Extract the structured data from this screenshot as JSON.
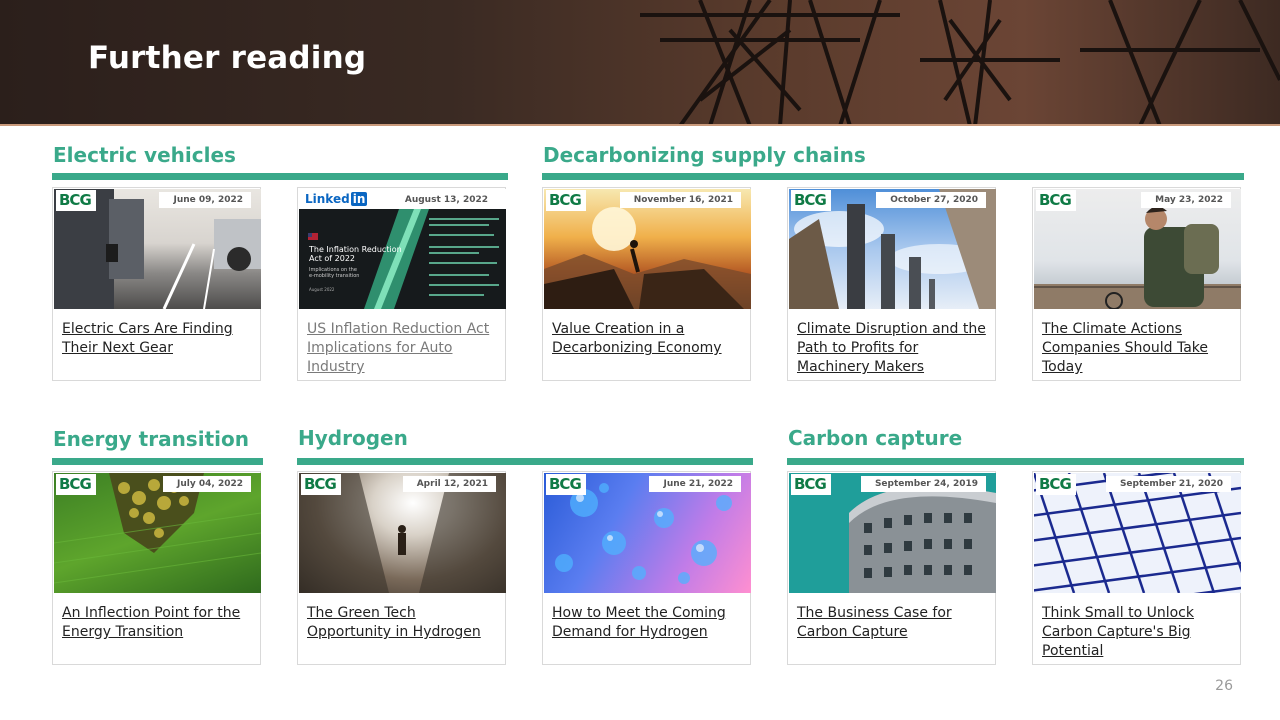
{
  "slide": {
    "title": "Further reading",
    "page_number": "26"
  },
  "sections": {
    "electric_vehicles": "Electric vehicles",
    "decarbonizing_supply_chains": "Decarbonizing supply chains",
    "energy_transition": "Energy transition",
    "hydrogen": "Hydrogen",
    "carbon_capture": "Carbon capture"
  },
  "brand": {
    "bcg": "BCG",
    "linkedin_text": "Linked",
    "linkedin_box": "in"
  },
  "thumbnail_text": {
    "inflation_title_1": "The Inflation Reduction",
    "inflation_title_2": "Act of 2022",
    "inflation_sub_1": "Implications on the",
    "inflation_sub_2": "e-mobility transition",
    "inflation_date": "August 2022"
  },
  "cards": [
    {
      "date": "June 09, 2022",
      "title": "Electric Cars Are Finding Their Next Gear"
    },
    {
      "date": "August 13, 2022",
      "title": "US Inflation Reduction Act Implications for Auto Industry"
    },
    {
      "date": "November 16, 2021",
      "title": "Value Creation in a Decarbonizing Economy"
    },
    {
      "date": "October 27, 2020",
      "title": "Climate Disruption and the Path to Profits for Machinery Makers"
    },
    {
      "date": "May 23, 2022",
      "title": "The Climate Actions Companies Should Take Today"
    },
    {
      "date": "July 04, 2022",
      "title": "An Inflection Point for the Energy Transition"
    },
    {
      "date": "April 12, 2021",
      "title": "The Green Tech Opportunity in Hydrogen"
    },
    {
      "date": "June 21, 2022",
      "title": "How to Meet the Coming Demand for Hydrogen"
    },
    {
      "date": "September 24, 2019",
      "title": "The Business Case for Carbon Capture"
    },
    {
      "date": "September 21, 2020",
      "title": "Think Small to Unlock Carbon Capture's Big Potential"
    }
  ],
  "colors": {
    "accent": "#3aa98a",
    "header_dark": "#2b1f1b",
    "brand_green": "#0f7a45",
    "linkedin_blue": "#0a66c2"
  }
}
